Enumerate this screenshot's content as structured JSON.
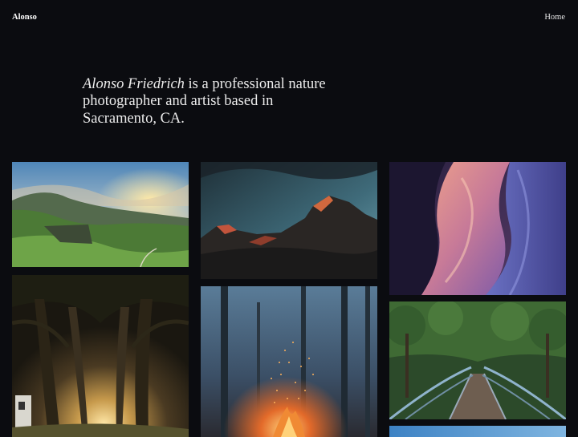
{
  "site": {
    "brand": "Alonso",
    "nav": [
      {
        "label": "Home"
      }
    ]
  },
  "intro": {
    "name": "Alonso Friedrich",
    "text": " is a professional nature photographer and artist based in Sacramento, CA."
  },
  "gallery": {
    "photos": [
      {
        "subject": "green-valley-sunset"
      },
      {
        "subject": "mountain-peaks-dusk"
      },
      {
        "subject": "slot-canyon-rocks"
      },
      {
        "subject": "tree-tunnel-sunlight"
      },
      {
        "subject": "campfire-sparks-forest"
      },
      {
        "subject": "forest-footbridge"
      },
      {
        "subject": "blue-sky-horizon"
      }
    ]
  }
}
